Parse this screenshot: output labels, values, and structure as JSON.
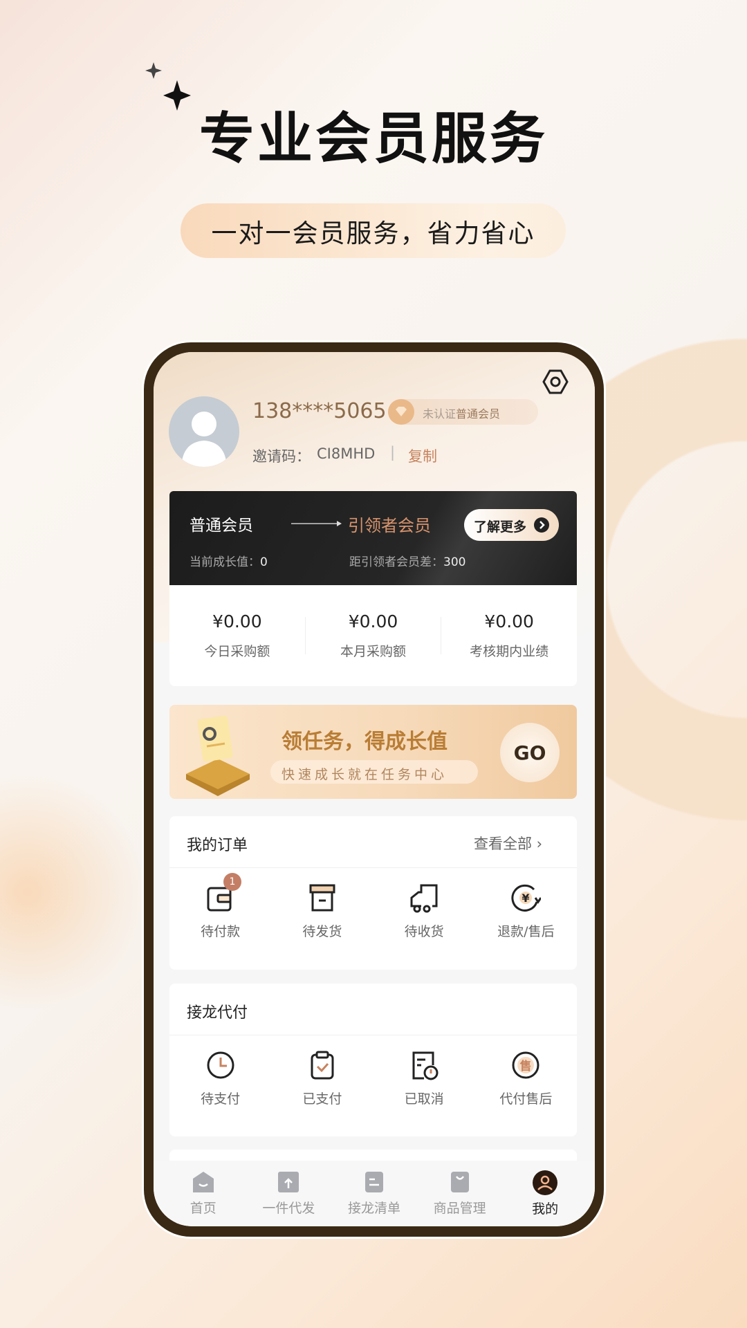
{
  "promo": {
    "headline": "专业会员服务",
    "subheadline": "一对一会员服务，省力省心"
  },
  "profile": {
    "phone": "138****5065",
    "badge_prefix": "未认证",
    "badge_level": "普通会员",
    "invite_label": "邀请码：",
    "invite_code": "CI8MHD",
    "separator": "|",
    "copy_label": "复制"
  },
  "membership": {
    "current_level": "普通会员",
    "next_level": "引领者会员",
    "learn_more": "了解更多",
    "growth_label": "当前成长值：",
    "growth_value": "0",
    "gap_label": "距引领者会员差：",
    "gap_value": "300"
  },
  "stats": [
    {
      "value": "¥0.00",
      "label": "今日采购额"
    },
    {
      "value": "¥0.00",
      "label": "本月采购额"
    },
    {
      "value": "¥0.00",
      "label": "考核期内业绩"
    }
  ],
  "task_banner": {
    "title": "领任务，得成长值",
    "subtitle": "快速成长就在任务中心",
    "go": "GO"
  },
  "orders": {
    "title": "我的订单",
    "view_all": "查看全部",
    "items": [
      {
        "label": "待付款",
        "icon": "wallet-icon",
        "badge": "1"
      },
      {
        "label": "待发货",
        "icon": "box-icon"
      },
      {
        "label": "待收货",
        "icon": "truck-icon"
      },
      {
        "label": "退款/售后",
        "icon": "refund-icon"
      }
    ]
  },
  "relay": {
    "title": "接龙代付",
    "items": [
      {
        "label": "待支付",
        "icon": "clock-icon"
      },
      {
        "label": "已支付",
        "icon": "clipboard-check-icon"
      },
      {
        "label": "已取消",
        "icon": "document-cancel-icon"
      },
      {
        "label": "代付售后",
        "icon": "after-sale-icon"
      }
    ]
  },
  "tabbar": {
    "items": [
      {
        "label": "首页",
        "icon": "home-icon"
      },
      {
        "label": "一件代发",
        "icon": "dropship-icon"
      },
      {
        "label": "接龙清单",
        "icon": "list-icon"
      },
      {
        "label": "商品管理",
        "icon": "bag-icon"
      },
      {
        "label": "我的",
        "icon": "profile-icon",
        "active": true
      }
    ]
  },
  "colors": {
    "accent": "#c7835f",
    "frame": "#3a2914",
    "gold": "#c98a3a"
  }
}
